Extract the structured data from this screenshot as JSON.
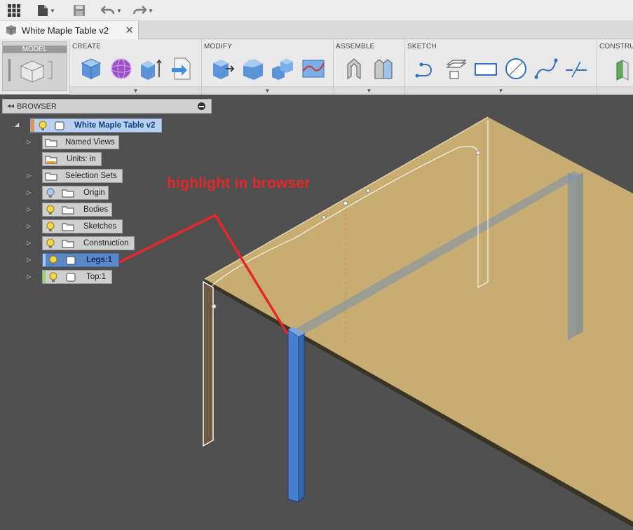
{
  "document": {
    "tab_title": "White Maple Table v2"
  },
  "ribbon": {
    "workspace_label": "MODEL",
    "groups": [
      {
        "label": "CREATE"
      },
      {
        "label": "MODIFY"
      },
      {
        "label": "ASSEMBLE"
      },
      {
        "label": "SKETCH"
      },
      {
        "label": "CONSTRU"
      }
    ]
  },
  "browser": {
    "header": "BROWSER",
    "root": "White Maple Table v2",
    "nodes": [
      {
        "label": "Named Views"
      },
      {
        "label": "Units: in"
      },
      {
        "label": "Selection Sets"
      },
      {
        "label": "Origin"
      },
      {
        "label": "Bodies"
      },
      {
        "label": "Sketches"
      },
      {
        "label": "Construction"
      },
      {
        "label": "Legs:1",
        "highlighted": true
      },
      {
        "label": "Top:1"
      }
    ]
  },
  "annotation": {
    "text": "highlight in browser",
    "color": "#e8262a"
  },
  "colors": {
    "accent_selected": "#4a7fd0",
    "table_top": "#c8ad73",
    "viewport_bg": "#505050"
  }
}
